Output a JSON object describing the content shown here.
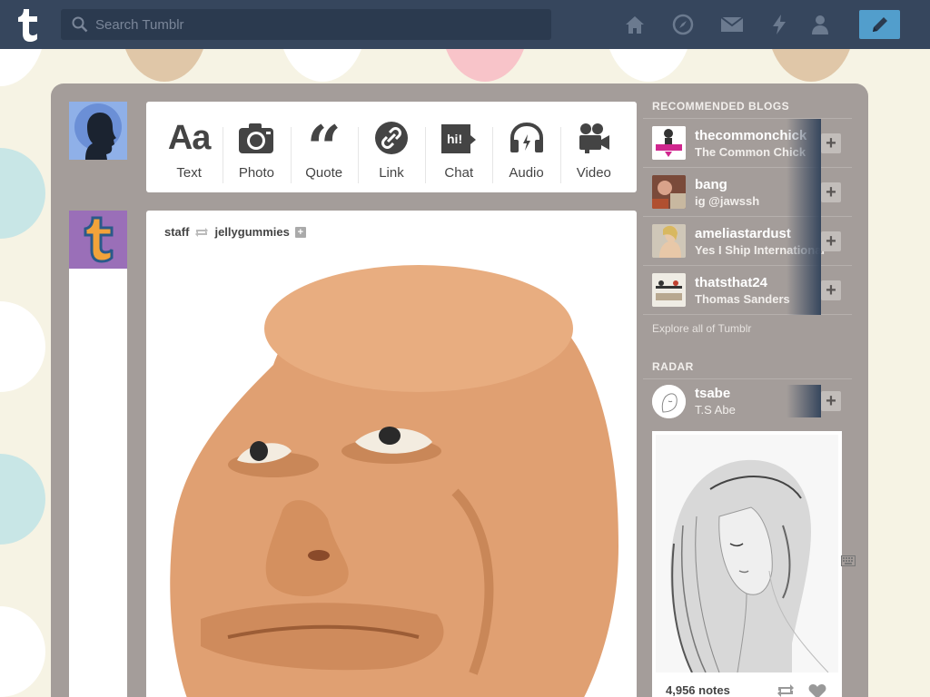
{
  "colors": {
    "topbar": "#36465d",
    "search_bg": "#2b3a4f",
    "compose_button": "#529ecc",
    "dashboard_bg": "#a49d9a",
    "page_bg": "#f6f3e4"
  },
  "header": {
    "logo_icon": "tumblr-logo-icon",
    "search_placeholder": "Search Tumblr",
    "nav_icons": [
      "home-icon",
      "compass-icon",
      "mail-icon",
      "lightning-icon",
      "user-icon"
    ],
    "compose_icon": "pencil-icon"
  },
  "post_types": [
    {
      "label": "Text",
      "icon": "text-icon"
    },
    {
      "label": "Photo",
      "icon": "camera-icon"
    },
    {
      "label": "Quote",
      "icon": "quote-icon"
    },
    {
      "label": "Link",
      "icon": "link-icon"
    },
    {
      "label": "Chat",
      "icon": "chat-icon"
    },
    {
      "label": "Audio",
      "icon": "headphones-icon"
    },
    {
      "label": "Video",
      "icon": "video-camera-icon"
    }
  ],
  "post": {
    "author": "staff",
    "reblogged_from": "jellygummies"
  },
  "sidebar": {
    "recommended_title": "RECOMMENDED BLOGS",
    "recommended": [
      {
        "name": "thecommonchick",
        "subtitle": "The Common Chick"
      },
      {
        "name": "bang",
        "subtitle": "ig @jawssh"
      },
      {
        "name": "ameliastardust",
        "subtitle": "Yes I Ship International"
      },
      {
        "name": "thatsthat24",
        "subtitle": "Thomas Sanders"
      }
    ],
    "explore_label": "Explore all of Tumblr",
    "radar_title": "RADAR",
    "radar": {
      "name": "tsabe",
      "subtitle": "T.S Abe",
      "notes": "4,956 notes"
    }
  }
}
